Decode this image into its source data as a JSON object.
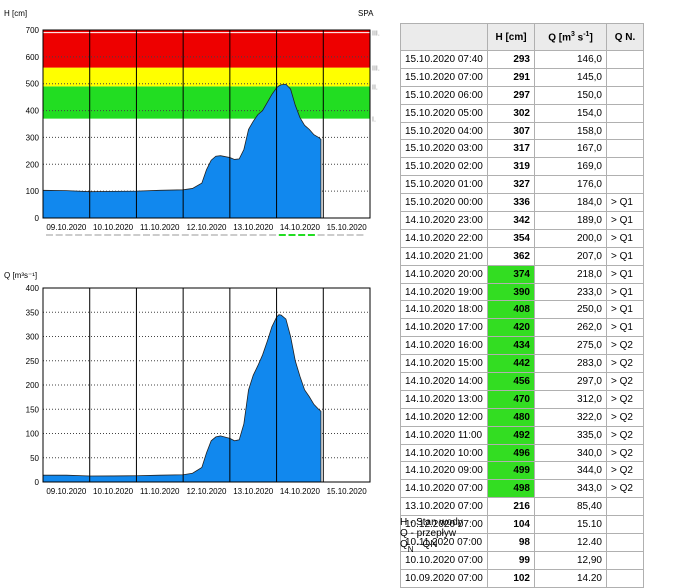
{
  "h_chart": {
    "ylabel": "H [cm]",
    "station": "SPA",
    "level_labels": [
      "I.",
      "II.",
      "III.",
      "III.!"
    ],
    "yticks": [
      "0",
      "100",
      "200",
      "300",
      "400",
      "500",
      "600",
      "700"
    ],
    "xticks": [
      "09.10.2020",
      "10.10.2020",
      "11.10.2020",
      "12.10.2020",
      "13.10.2020",
      "14.10.2020",
      "15.10.2020"
    ],
    "colors": {
      "red": "#ee0000",
      "yellow": "#ffff00",
      "green": "#22dd22",
      "fill": "#1188ee"
    }
  },
  "q_chart": {
    "ylabel": "Q [m³s⁻¹]",
    "yticks": [
      "0",
      "50",
      "100",
      "150",
      "200",
      "250",
      "300",
      "350",
      "400"
    ],
    "xticks": [
      "09.10.2020",
      "10.10.2020",
      "11.10.2020",
      "12.10.2020",
      "13.10.2020",
      "14.10.2020",
      "15.10.2020"
    ]
  },
  "chart_data": [
    {
      "type": "area",
      "ylabel": "H [cm]",
      "ylim": [
        0,
        700
      ],
      "x_unit": "days from 09.10.2020 00:00",
      "zones": [
        {
          "label": "I.",
          "from": 370,
          "to": 490,
          "color": "#22dd22"
        },
        {
          "label": "II.",
          "from": 490,
          "to": 560,
          "color": "#ffff00"
        },
        {
          "label": "III.",
          "from": 560,
          "to": 700,
          "color": "#ee0000"
        }
      ],
      "x": [
        0,
        0.5,
        1,
        1.5,
        2,
        2.5,
        3,
        3.2,
        3.4,
        3.5,
        3.6,
        3.7,
        3.8,
        4.0,
        4.1,
        4.2,
        4.3,
        4.4,
        4.5,
        4.6,
        4.7,
        4.8,
        4.9,
        5.0,
        5.05,
        5.1,
        5.2,
        5.3,
        5.4,
        5.5,
        5.6,
        5.7,
        5.8,
        5.9,
        5.95
      ],
      "values": [
        103,
        102,
        98,
        99,
        100,
        103,
        105,
        110,
        130,
        180,
        215,
        230,
        232,
        225,
        218,
        220,
        255,
        330,
        360,
        385,
        400,
        430,
        460,
        485,
        492,
        496,
        498,
        480,
        420,
        374,
        345,
        330,
        310,
        300,
        293
      ]
    },
    {
      "type": "area",
      "ylabel": "Q [m³s⁻¹]",
      "ylim": [
        0,
        400
      ],
      "x_unit": "days from 09.10.2020 00:00",
      "x": [
        0,
        0.5,
        1,
        1.5,
        2,
        2.5,
        3,
        3.2,
        3.4,
        3.5,
        3.6,
        3.7,
        3.8,
        4.0,
        4.1,
        4.2,
        4.3,
        4.4,
        4.5,
        4.6,
        4.7,
        4.8,
        4.9,
        5.0,
        5.05,
        5.1,
        5.2,
        5.3,
        5.4,
        5.5,
        5.6,
        5.7,
        5.8,
        5.9,
        5.95
      ],
      "values": [
        14,
        14,
        12.4,
        12.5,
        12.9,
        14,
        15,
        18,
        30,
        60,
        85,
        93,
        95,
        90,
        85,
        87,
        120,
        190,
        220,
        240,
        262,
        290,
        320,
        340,
        345,
        344,
        336,
        300,
        250,
        218,
        190,
        176,
        160,
        150,
        146
      ]
    }
  ],
  "table": {
    "headers": {
      "dt": "",
      "h": "H [cm]",
      "q_pre": "Q [m",
      "q_sup3": "3",
      "q_mid": "s",
      "q_supm1": "-1",
      "q_post": "]",
      "qn": "Q N."
    },
    "rows": [
      {
        "dt": "15.10.2020 07:40",
        "h": "293",
        "q": "146,0",
        "qn": "",
        "hl": false
      },
      {
        "dt": "15.10.2020 07:00",
        "h": "291",
        "q": "145,0",
        "qn": "",
        "hl": false
      },
      {
        "dt": "15.10.2020 06:00",
        "h": "297",
        "q": "150,0",
        "qn": "",
        "hl": false
      },
      {
        "dt": "15.10.2020 05:00",
        "h": "302",
        "q": "154,0",
        "qn": "",
        "hl": false
      },
      {
        "dt": "15.10.2020 04:00",
        "h": "307",
        "q": "158,0",
        "qn": "",
        "hl": false
      },
      {
        "dt": "15.10.2020 03:00",
        "h": "317",
        "q": "167,0",
        "qn": "",
        "hl": false
      },
      {
        "dt": "15.10.2020 02:00",
        "h": "319",
        "q": "169,0",
        "qn": "",
        "hl": false
      },
      {
        "dt": "15.10.2020 01:00",
        "h": "327",
        "q": "176,0",
        "qn": "",
        "hl": false
      },
      {
        "dt": "15.10.2020 00:00",
        "h": "336",
        "q": "184,0",
        "qn": "> Q1",
        "hl": false
      },
      {
        "dt": "14.10.2020 23:00",
        "h": "342",
        "q": "189,0",
        "qn": "> Q1",
        "hl": false
      },
      {
        "dt": "14.10.2020 22:00",
        "h": "354",
        "q": "200,0",
        "qn": "> Q1",
        "hl": false
      },
      {
        "dt": "14.10.2020 21:00",
        "h": "362",
        "q": "207,0",
        "qn": "> Q1",
        "hl": false
      },
      {
        "dt": "14.10.2020 20:00",
        "h": "374",
        "q": "218,0",
        "qn": "> Q1",
        "hl": true
      },
      {
        "dt": "14.10.2020 19:00",
        "h": "390",
        "q": "233,0",
        "qn": "> Q1",
        "hl": true
      },
      {
        "dt": "14.10.2020 18:00",
        "h": "408",
        "q": "250,0",
        "qn": "> Q1",
        "hl": true
      },
      {
        "dt": "14.10.2020 17:00",
        "h": "420",
        "q": "262,0",
        "qn": "> Q1",
        "hl": true
      },
      {
        "dt": "14.10.2020 16:00",
        "h": "434",
        "q": "275,0",
        "qn": "> Q2",
        "hl": true
      },
      {
        "dt": "14.10.2020 15:00",
        "h": "442",
        "q": "283,0",
        "qn": "> Q2",
        "hl": true
      },
      {
        "dt": "14.10.2020 14:00",
        "h": "456",
        "q": "297,0",
        "qn": "> Q2",
        "hl": true
      },
      {
        "dt": "14.10.2020 13:00",
        "h": "470",
        "q": "312,0",
        "qn": "> Q2",
        "hl": true
      },
      {
        "dt": "14.10.2020 12:00",
        "h": "480",
        "q": "322,0",
        "qn": "> Q2",
        "hl": true
      },
      {
        "dt": "14.10.2020 11:00",
        "h": "492",
        "q": "335,0",
        "qn": "> Q2",
        "hl": true
      },
      {
        "dt": "14.10.2020 10:00",
        "h": "496",
        "q": "340,0",
        "qn": "> Q2",
        "hl": true
      },
      {
        "dt": "14.10.2020 09:00",
        "h": "499",
        "q": "344,0",
        "qn": "> Q2",
        "hl": true
      },
      {
        "dt": "14.10.2020 07:00",
        "h": "498",
        "q": "343,0",
        "qn": "> Q2",
        "hl": true
      },
      {
        "dt": "13.10.2020 07:00",
        "h": "216",
        "q": "85,40",
        "qn": "",
        "hl": false
      },
      {
        "dt": "10.12.2020 07:00",
        "h": "104",
        "q": "15.10",
        "qn": "",
        "hl": false
      },
      {
        "dt": "10.11.2020 07:00",
        "h": "98",
        "q": "12.40",
        "qn": "",
        "hl": false
      },
      {
        "dt": "10.10.2020 07:00",
        "h": "99",
        "q": "12,90",
        "qn": "",
        "hl": false
      },
      {
        "dt": "10.09.2020 07:00",
        "h": "102",
        "q": "14.20",
        "qn": "",
        "hl": false
      }
    ]
  },
  "legend": {
    "h": "H - Stan wody",
    "q": "Q - przepływ",
    "qn_main": "Q",
    "qn_sub": "N",
    "qn_rest": " - QN"
  }
}
